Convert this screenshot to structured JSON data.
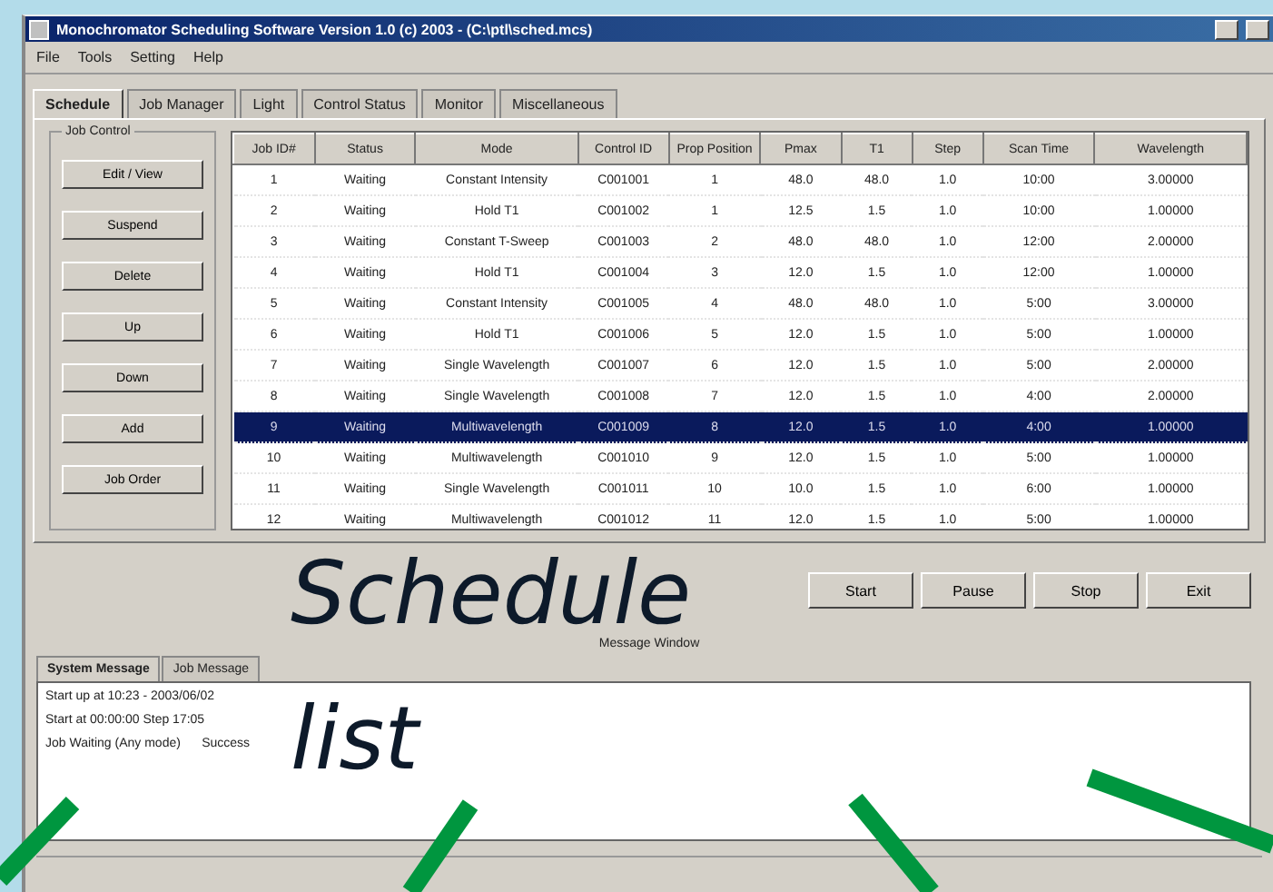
{
  "window": {
    "title": "Monochromator Scheduling Software Version 1.0 (c) 2003 - (C:\\ptl\\sched.mcs)"
  },
  "menu": [
    "File",
    "Tools",
    "Setting",
    "Help"
  ],
  "tabs": [
    {
      "label": "Schedule",
      "selected": true
    },
    {
      "label": "Job Manager",
      "selected": false
    },
    {
      "label": "Light",
      "selected": false
    },
    {
      "label": "Control Status",
      "selected": false
    },
    {
      "label": "Monitor",
      "selected": false
    },
    {
      "label": "Miscellaneous",
      "selected": false
    }
  ],
  "side_group": {
    "title": "Job Control"
  },
  "side_buttons": [
    "Edit / View",
    "Suspend",
    "Delete",
    "Up",
    "Down",
    "Add",
    "Job Order"
  ],
  "table": {
    "columns": [
      "Job ID#",
      "Status",
      "Mode",
      "Control ID",
      "Prop Position",
      "Pmax",
      "T1",
      "Step",
      "Scan Time",
      "Wavelength"
    ],
    "rows": [
      {
        "selected": false,
        "cells": [
          "1",
          "Waiting",
          "Constant Intensity",
          "C001001",
          "1",
          "48.0",
          "48.0",
          "1.0",
          "10:00",
          "3.00000"
        ]
      },
      {
        "selected": false,
        "cells": [
          "2",
          "Waiting",
          "Hold T1",
          "C001002",
          "1",
          "12.5",
          "1.5",
          "1.0",
          "10:00",
          "1.00000"
        ]
      },
      {
        "selected": false,
        "cells": [
          "3",
          "Waiting",
          "Constant T-Sweep",
          "C001003",
          "2",
          "48.0",
          "48.0",
          "1.0",
          "12:00",
          "2.00000"
        ]
      },
      {
        "selected": false,
        "cells": [
          "4",
          "Waiting",
          "Hold T1",
          "C001004",
          "3",
          "12.0",
          "1.5",
          "1.0",
          "12:00",
          "1.00000"
        ]
      },
      {
        "selected": false,
        "cells": [
          "5",
          "Waiting",
          "Constant Intensity",
          "C001005",
          "4",
          "48.0",
          "48.0",
          "1.0",
          "5:00",
          "3.00000"
        ]
      },
      {
        "selected": false,
        "cells": [
          "6",
          "Waiting",
          "Hold T1",
          "C001006",
          "5",
          "12.0",
          "1.5",
          "1.0",
          "5:00",
          "1.00000"
        ]
      },
      {
        "selected": false,
        "cells": [
          "7",
          "Waiting",
          "Single Wavelength",
          "C001007",
          "6",
          "12.0",
          "1.5",
          "1.0",
          "5:00",
          "2.00000"
        ]
      },
      {
        "selected": false,
        "cells": [
          "8",
          "Waiting",
          "Single Wavelength",
          "C001008",
          "7",
          "12.0",
          "1.5",
          "1.0",
          "4:00",
          "2.00000"
        ]
      },
      {
        "selected": true,
        "cells": [
          "9",
          "Waiting",
          "Multiwavelength",
          "C001009",
          "8",
          "12.0",
          "1.5",
          "1.0",
          "4:00",
          "1.00000"
        ]
      },
      {
        "selected": false,
        "cells": [
          "10",
          "Waiting",
          "Multiwavelength",
          "C001010",
          "9",
          "12.0",
          "1.5",
          "1.0",
          "5:00",
          "1.00000"
        ]
      },
      {
        "selected": false,
        "cells": [
          "11",
          "Waiting",
          "Single Wavelength",
          "C001011",
          "10",
          "10.0",
          "1.5",
          "1.0",
          "6:00",
          "1.00000"
        ]
      },
      {
        "selected": false,
        "cells": [
          "12",
          "Waiting",
          "Multiwavelength",
          "C001012",
          "11",
          "12.0",
          "1.5",
          "1.0",
          "5:00",
          "1.00000"
        ]
      }
    ]
  },
  "run_buttons": [
    "Start",
    "Pause",
    "Stop",
    "Exit"
  ],
  "message_window": {
    "title": "Message Window",
    "tabs": [
      {
        "label": "System Message",
        "selected": true
      },
      {
        "label": "Job Message",
        "selected": false
      }
    ],
    "lines": [
      "Start up at 10:23 - 2003/06/02",
      "Start at 00:00:00 Step 17:05",
      "Job Waiting (Any mode)      Success"
    ]
  },
  "annotation": {
    "lines": [
      "Schedule",
      "list"
    ]
  }
}
